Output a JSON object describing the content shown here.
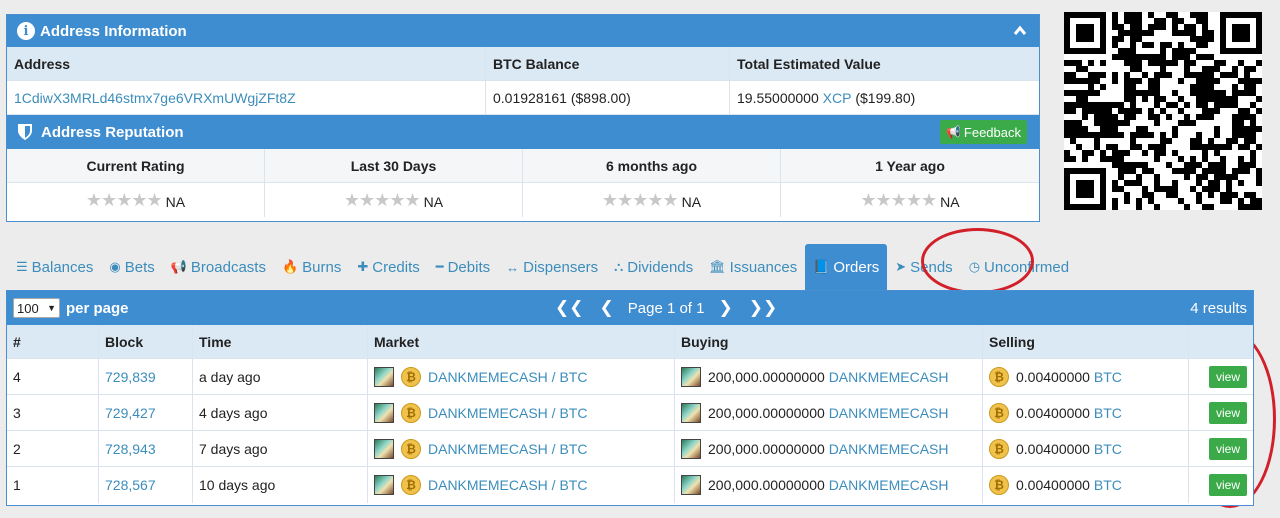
{
  "address_info": {
    "title": "Address Information",
    "columns": [
      "Address",
      "BTC Balance",
      "Total Estimated Value"
    ],
    "address": "1CdiwX3MRLd46stmx7ge6VRXmUWgjZFt8Z",
    "btc_balance": "0.01928161 ($898.00)",
    "total_amount": "19.55000000",
    "total_asset": "XCP",
    "total_usd": "($199.80)"
  },
  "reputation": {
    "title": "Address Reputation",
    "feedback_label": "Feedback",
    "columns": [
      "Current Rating",
      "Last 30 Days",
      "6 months ago",
      "1 Year ago"
    ],
    "stars": "★★★★★",
    "values": [
      "NA",
      "NA",
      "NA",
      "NA"
    ]
  },
  "tabs": [
    {
      "icon": "☰",
      "label": "Balances"
    },
    {
      "icon": "◉",
      "label": "Bets"
    },
    {
      "icon": "📢",
      "label": "Broadcasts"
    },
    {
      "icon": "🔥",
      "label": "Burns"
    },
    {
      "icon": "✚",
      "label": "Credits"
    },
    {
      "icon": "━",
      "label": "Debits"
    },
    {
      "icon": "↔",
      "label": "Dispensers"
    },
    {
      "icon": "⛬",
      "label": "Dividends"
    },
    {
      "icon": "🏛",
      "label": "Issuances"
    },
    {
      "icon": "📘",
      "label": "Orders"
    },
    {
      "icon": "➤",
      "label": "Sends"
    },
    {
      "icon": "◷",
      "label": "Unconfirmed"
    }
  ],
  "active_tab": "Orders",
  "orders": {
    "per_page_value": "100",
    "per_page_label": "per page",
    "page_text": "Page 1 of 1",
    "results": "4 results",
    "columns": [
      "#",
      "Block",
      "Time",
      "Market",
      "Buying",
      "Selling"
    ],
    "rows": [
      {
        "num": "4",
        "block": "729,839",
        "time": "a day ago",
        "market": "DANKMEMECASH / BTC",
        "buy_amount": "200,000.00000000",
        "buy_asset": "DANKMEMECASH",
        "sell_amount": "0.00400000",
        "sell_asset": "BTC",
        "action": "view"
      },
      {
        "num": "3",
        "block": "729,427",
        "time": "4 days ago",
        "market": "DANKMEMECASH / BTC",
        "buy_amount": "200,000.00000000",
        "buy_asset": "DANKMEMECASH",
        "sell_amount": "0.00400000",
        "sell_asset": "BTC",
        "action": "view"
      },
      {
        "num": "2",
        "block": "728,943",
        "time": "7 days ago",
        "market": "DANKMEMECASH / BTC",
        "buy_amount": "200,000.00000000",
        "buy_asset": "DANKMEMECASH",
        "sell_amount": "0.00400000",
        "sell_asset": "BTC",
        "action": "view"
      },
      {
        "num": "1",
        "block": "728,567",
        "time": "10 days ago",
        "market": "DANKMEMECASH / BTC",
        "buy_amount": "200,000.00000000",
        "buy_asset": "DANKMEMECASH",
        "sell_amount": "0.00400000",
        "sell_asset": "BTC",
        "action": "view"
      }
    ]
  },
  "colors": {
    "primary": "#3f8dd1",
    "link": "#3c8dbc",
    "success": "#3bab4a",
    "annotation": "#d2202a"
  }
}
